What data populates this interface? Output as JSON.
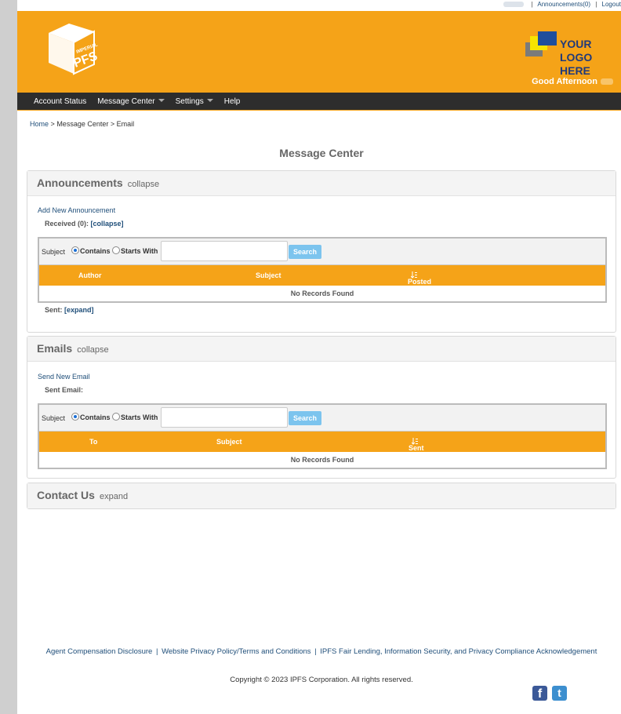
{
  "topbar": {
    "announcements": "Announcements(0)",
    "logout": "Logout"
  },
  "header": {
    "logo_text": "IMPERIAL PFS",
    "placeholder_logo": "YOUR\nLOGO HERE",
    "greeting": "Good Afternoon",
    "brand_color": "#f5a318"
  },
  "nav": {
    "items": [
      {
        "label": "Account Status"
      },
      {
        "label": "Message Center"
      },
      {
        "label": "Settings"
      },
      {
        "label": "Help"
      }
    ]
  },
  "breadcrumb": {
    "home": "Home",
    "sep": ">",
    "message_center": "Message Center",
    "email": "Email"
  },
  "page_title": "Message Center",
  "announcements": {
    "title": "Announcements",
    "toggle": "collapse",
    "add_link": "Add New Announcement",
    "received_label": "Received (0):",
    "received_toggle": "[collapse]",
    "search": {
      "label": "Subject",
      "opt_contains": "Contains",
      "opt_starts": "Starts With",
      "button": "Search",
      "value": ""
    },
    "columns": [
      "Author",
      "Subject",
      "Posted"
    ],
    "empty": "No Records Found",
    "sent_label": "Sent:",
    "sent_toggle": "[expand]"
  },
  "emails": {
    "title": "Emails",
    "toggle": "collapse",
    "send_link": "Send New Email",
    "sent_label": "Sent Email:",
    "search": {
      "label": "Subject",
      "opt_contains": "Contains",
      "opt_starts": "Starts With",
      "button": "Search",
      "value": ""
    },
    "columns": [
      "To",
      "Subject",
      "Sent"
    ],
    "empty": "No Records Found"
  },
  "contact": {
    "title": "Contact Us",
    "toggle": "expand"
  },
  "footer": {
    "links": [
      "Agent Compensation Disclosure",
      "Website Privacy Policy/Terms and Conditions",
      "IPFS Fair Lending, Information Security, and Privacy Compliance Acknowledgement"
    ],
    "sep": "|",
    "copyright": "Copyright © 2023 IPFS Corporation. All rights reserved.",
    "facebook_icon": "f",
    "twitter_icon": "t"
  }
}
